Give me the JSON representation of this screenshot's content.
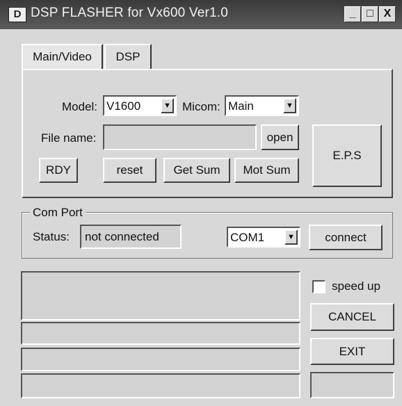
{
  "window": {
    "title": "DSP FLASHER for Vx600  Ver1.0",
    "icon_text": "D",
    "minimize": "_",
    "maximize": "□",
    "close": "X"
  },
  "tabs": [
    {
      "label": "Main/Video"
    },
    {
      "label": "DSP"
    }
  ],
  "main": {
    "model_label": "Model:",
    "model_value": "V1600",
    "micom_label": "Micom:",
    "micom_value": "Main",
    "file_label": "File name:",
    "file_value": "",
    "open_label": "open",
    "eps_label": "E.P.S",
    "rdy_label": "RDY",
    "reset_label": "reset",
    "get_sum_label": "Get Sum",
    "mot_sum_label": "Mot Sum"
  },
  "com_port": {
    "group_title": "Com Port",
    "status_label": "Status:",
    "status_value": "not connected",
    "port_value": "COM1",
    "connect_label": "connect"
  },
  "controls": {
    "speed_up_label": "speed up",
    "cancel_label": "CANCEL",
    "exit_label": "EXIT"
  },
  "icons": {
    "dropdown": "▼"
  },
  "colors": {
    "window_background": "#d8d8d8",
    "title_bar": "#4a4a4a",
    "field_background": "#ffffff"
  }
}
